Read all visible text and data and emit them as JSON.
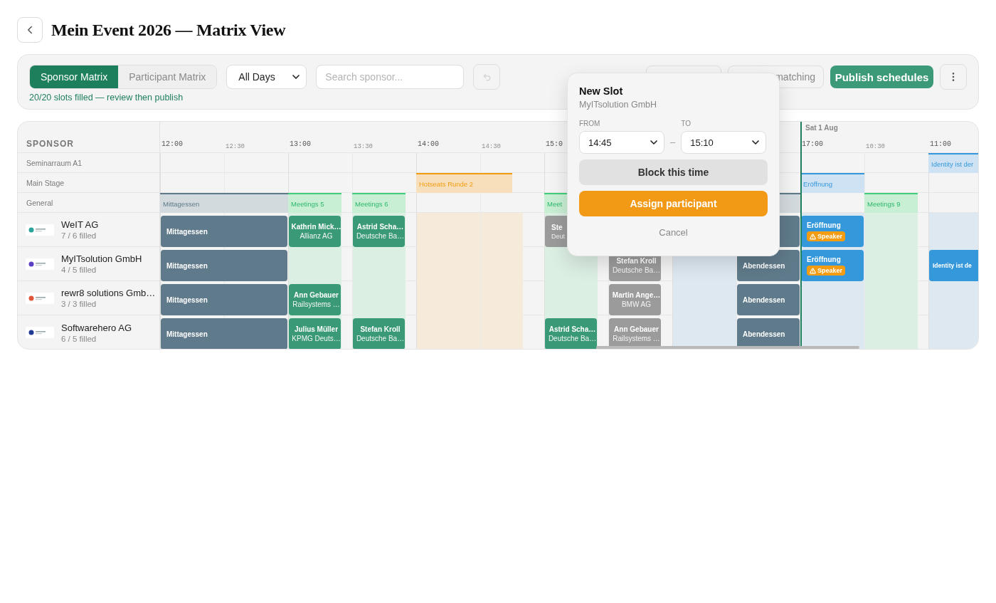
{
  "page": {
    "title": "Mein Event 2026 — Matrix View"
  },
  "toolbar": {
    "tabs": [
      {
        "label": "Sponsor Matrix",
        "selected": true
      },
      {
        "label": "Participant Matrix",
        "selected": false
      }
    ],
    "day_filter": {
      "value": "All Days"
    },
    "search": {
      "placeholder": "Search sponsor..."
    },
    "undo": {
      "disabled": true
    },
    "actions": [
      {
        "kind": "secondary"
      },
      {
        "kind": "secondary",
        "label": "matching"
      },
      {
        "kind": "primary",
        "label": "Publish schedules"
      },
      {
        "kind": "menu"
      }
    ],
    "status": "20/20 slots filled — review then publish"
  },
  "matrix": {
    "column_header": "SPONSOR",
    "day_label": "Sat 1 Aug",
    "times": [
      {
        "label": "12:00",
        "major": true
      },
      {
        "label": "12:30",
        "major": false
      },
      {
        "label": "13:00",
        "major": true
      },
      {
        "label": "13:30",
        "major": false
      },
      {
        "label": "14:00",
        "major": true
      },
      {
        "label": "14:30",
        "major": false
      },
      {
        "label": "15:0",
        "major": true
      },
      {
        "label": "17:00",
        "major": true
      },
      {
        "label": "10:30",
        "major": false
      },
      {
        "label": "11:00",
        "major": true
      }
    ],
    "rooms": [
      {
        "name": "Seminarraum A1"
      },
      {
        "name": "Main Stage"
      },
      {
        "name": "General"
      }
    ],
    "room_blocks": [
      {
        "kind": "session",
        "label": "Identity ist der"
      },
      {
        "kind": "hotseat",
        "label": "Hotseats Runde 2"
      },
      {
        "kind": "session",
        "label": "Eröffnung"
      },
      {
        "kind": "lunch",
        "label": "Mittagessen"
      },
      {
        "kind": "meeting",
        "label": "Meetings 5"
      },
      {
        "kind": "meeting",
        "label": "Meetings 6"
      },
      {
        "kind": "meeting",
        "label": "Meet"
      },
      {
        "kind": "lunch"
      },
      {
        "kind": "meeting",
        "label": "Meetings 9"
      }
    ],
    "sponsors": [
      {
        "name": "WeIT AG",
        "filled": "7 / 6 filled",
        "color": "#2aa39a",
        "blocks": [
          {
            "kind": "lunch",
            "title": "Mittagessen"
          },
          {
            "kind": "meeting",
            "title": "Kathrin Mick…",
            "sub": "Allianz AG"
          },
          {
            "kind": "meeting",
            "title": "Astrid Scha…",
            "sub": "Deutsche Ba…"
          },
          {
            "kind": "pending",
            "title": "Ste",
            "sub": "Deut"
          },
          {
            "kind": "dinner"
          },
          {
            "kind": "session",
            "title": "Eröffnung",
            "badge": "Speaker"
          }
        ]
      },
      {
        "name": "MyITsolution GmbH",
        "filled": "4 / 5 filled",
        "color": "#5b3fc4",
        "blocks": [
          {
            "kind": "lunch",
            "title": "Mittagessen"
          },
          {
            "kind": "pending",
            "title": "Stefan Kroll",
            "sub": "Deutsche Ba…"
          },
          {
            "kind": "dinner",
            "title": "Abendessen"
          },
          {
            "kind": "session",
            "title": "Eröffnung",
            "badge": "Speaker"
          },
          {
            "kind": "session",
            "title": "Identity ist de"
          }
        ]
      },
      {
        "name": "rewr8 solutions Gmb…",
        "filled": "3 / 3 filled",
        "color": "#e0553a",
        "blocks": [
          {
            "kind": "lunch",
            "title": "Mittagessen"
          },
          {
            "kind": "meeting",
            "title": "Ann Gebauer",
            "sub": "Railsystems …"
          },
          {
            "kind": "pending",
            "title": "Martin Ange…",
            "sub": "BMW AG"
          },
          {
            "kind": "dinner",
            "title": "Abendessen"
          }
        ]
      },
      {
        "name": "Softwarehero AG",
        "filled": "6 / 5 filled",
        "color": "#1f3a93",
        "blocks": [
          {
            "kind": "lunch",
            "title": "Mittagessen"
          },
          {
            "kind": "meeting",
            "title": "Julius Müller",
            "sub": "KPMG Deuts…"
          },
          {
            "kind": "meeting",
            "title": "Stefan Kroll",
            "sub": "Deutsche Ba…"
          },
          {
            "kind": "meeting",
            "title": "Astrid Scha…",
            "sub": "Deutsche Ba…"
          },
          {
            "kind": "pending",
            "title": "Ann Gebauer",
            "sub": "Railsystems …"
          },
          {
            "kind": "dinner",
            "title": "Abendessen"
          }
        ]
      }
    ]
  },
  "popup": {
    "title": "New Slot",
    "subtitle": "MyITsolution GmbH",
    "from_label": "FROM",
    "from_value": "14:45",
    "separator": "–",
    "to_label": "TO",
    "to_value": "15:10",
    "buttons": [
      {
        "kind": "secondary",
        "label": "Block this time"
      },
      {
        "kind": "primary",
        "label": "Assign participant"
      },
      {
        "kind": "link",
        "label": "Cancel"
      }
    ]
  }
}
